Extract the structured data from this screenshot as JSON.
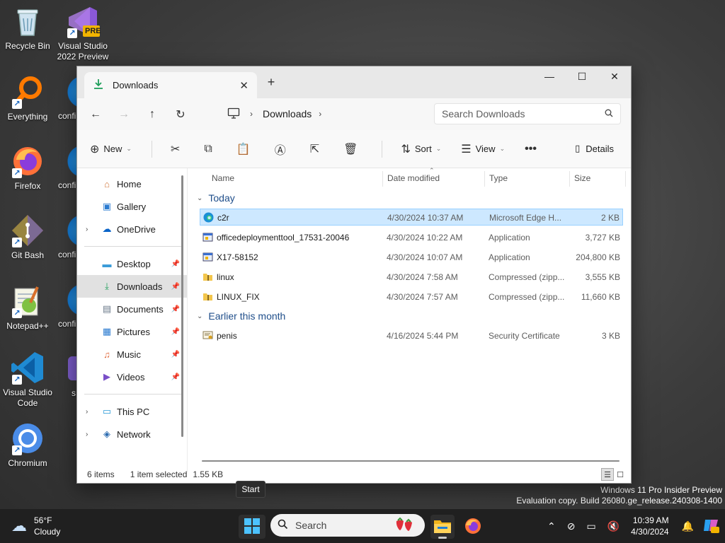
{
  "desktop": {
    "icons": [
      {
        "label": "Recycle Bin"
      },
      {
        "label": "Visual Studio 2022 Preview",
        "badge": "PRE"
      },
      {
        "label": "Everything"
      },
      {
        "label": "Firefox"
      },
      {
        "label": "Git Bash"
      },
      {
        "label": "Notepad++"
      },
      {
        "label": "Visual Studio Code"
      },
      {
        "label": "Chromium"
      }
    ],
    "partial_labels": [
      "confi",
      "confi",
      "confi",
      "confi",
      "s"
    ],
    "watermark": {
      "line1": "Windows 11 Pro Insider Preview",
      "line2": "Evaluation copy. Build 26080.ge_release.240308-1400"
    }
  },
  "window": {
    "tab_title": "Downloads",
    "breadcrumb": "Downloads",
    "search_placeholder": "Search Downloads",
    "toolbar": {
      "new_label": "New",
      "sort_label": "Sort",
      "view_label": "View",
      "details_label": "Details"
    },
    "nav": {
      "home": "Home",
      "gallery": "Gallery",
      "onedrive": "OneDrive",
      "desktop": "Desktop",
      "downloads": "Downloads",
      "documents": "Documents",
      "pictures": "Pictures",
      "music": "Music",
      "videos": "Videos",
      "thispc": "This PC",
      "network": "Network"
    },
    "columns": {
      "name": "Name",
      "date": "Date modified",
      "type": "Type",
      "size": "Size"
    },
    "groups": {
      "today": "Today",
      "earlier": "Earlier this month"
    },
    "files_today": [
      {
        "name": "c2r",
        "date": "4/30/2024 10:37 AM",
        "type": "Microsoft Edge H...",
        "size": "2 KB",
        "icon": "edge-icon"
      },
      {
        "name": "officedeploymenttool_17531-20046",
        "date": "4/30/2024 10:22 AM",
        "type": "Application",
        "size": "3,727 KB",
        "icon": "exe-icon"
      },
      {
        "name": "X17-58152",
        "date": "4/30/2024 10:07 AM",
        "type": "Application",
        "size": "204,800 KB",
        "icon": "exe-icon"
      },
      {
        "name": "linux",
        "date": "4/30/2024 7:58 AM",
        "type": "Compressed (zipp...",
        "size": "3,555 KB",
        "icon": "zip-folder-icon"
      },
      {
        "name": "LINUX_FIX",
        "date": "4/30/2024 7:57 AM",
        "type": "Compressed (zipp...",
        "size": "11,660 KB",
        "icon": "zip-folder-icon"
      }
    ],
    "files_earlier": [
      {
        "name": "penis",
        "date": "4/16/2024 5:44 PM",
        "type": "Security Certificate",
        "size": "3 KB",
        "icon": "certificate-icon"
      }
    ],
    "status": {
      "count": "6 items",
      "selection": "1 item selected",
      "sel_size": "1.55 KB"
    }
  },
  "tooltip": "Start",
  "taskbar": {
    "weather_temp": "56°F",
    "weather_desc": "Cloudy",
    "search_placeholder": "Search",
    "time": "10:39 AM",
    "date": "4/30/2024"
  },
  "colors": {
    "selection_bg": "#cde8ff",
    "accent": "#0067c0",
    "taskbar": "#202020"
  }
}
